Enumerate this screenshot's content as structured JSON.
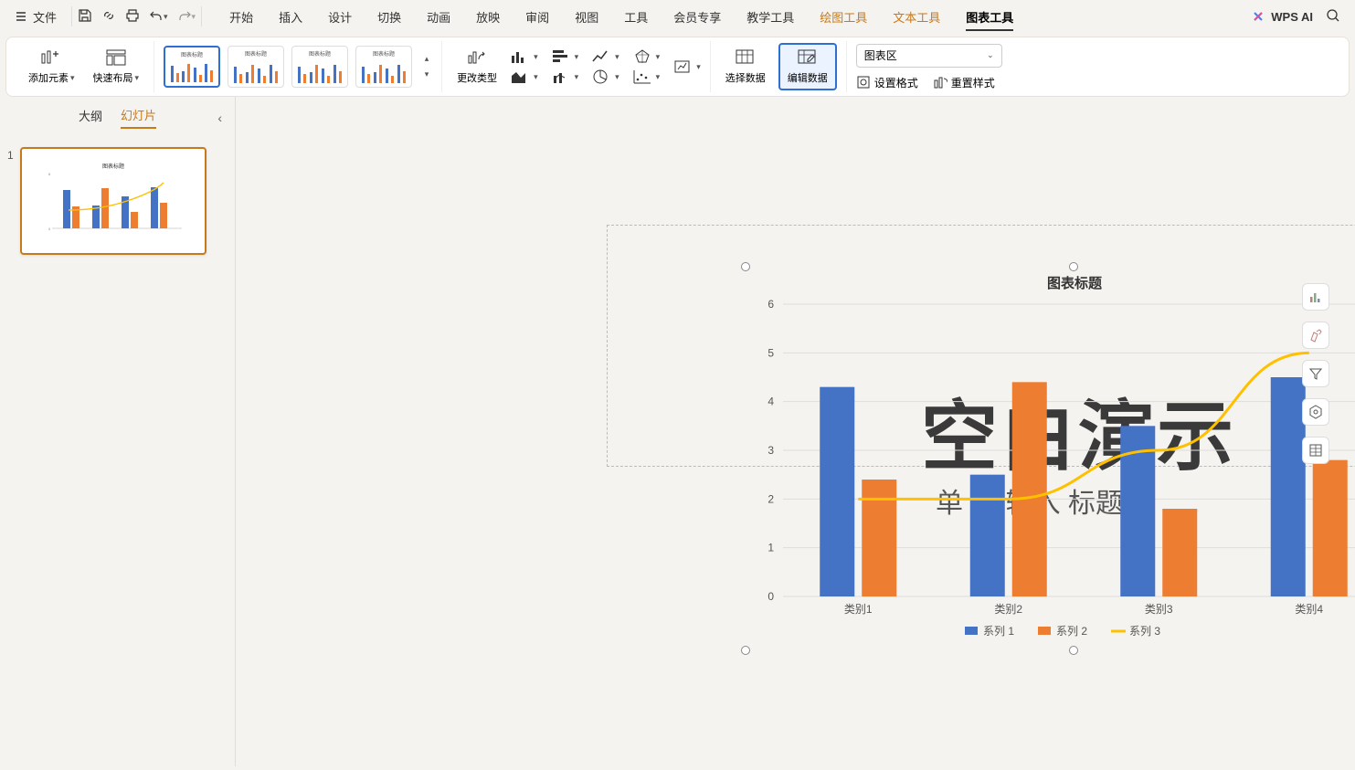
{
  "menu": {
    "file": "文件",
    "tabs": [
      "开始",
      "插入",
      "设计",
      "切换",
      "动画",
      "放映",
      "审阅",
      "视图",
      "工具",
      "会员专享",
      "教学工具"
    ],
    "accent_tabs": [
      "绘图工具",
      "文本工具"
    ],
    "active_tab": "图表工具",
    "wps_ai": "WPS AI"
  },
  "ribbon": {
    "add_element": "添加元素",
    "quick_layout": "快速布局",
    "change_type": "更改类型",
    "select_data": "选择数据",
    "edit_data": "编辑数据",
    "chart_area": "图表区",
    "set_format": "设置格式",
    "reset_style": "重置样式"
  },
  "side": {
    "outline": "大纲",
    "slides": "幻灯片",
    "slide_num": "1"
  },
  "slide": {
    "title_placeholder": "空白演示",
    "subtitle_placeholder": "单    此    输入    标题"
  },
  "right_tools": {
    "t1": "chart-elements",
    "t2": "format-brush",
    "t3": "filter",
    "t4": "settings-hex",
    "t5": "data-table"
  },
  "chart_data": {
    "type": "bar+line",
    "title": "图表标题",
    "categories": [
      "类别1",
      "类别2",
      "类别3",
      "类别4"
    ],
    "series": [
      {
        "name": "系列 1",
        "type": "bar",
        "color": "#4472c4",
        "values": [
          4.3,
          2.5,
          3.5,
          4.5
        ]
      },
      {
        "name": "系列 2",
        "type": "bar",
        "color": "#ed7d31",
        "values": [
          2.4,
          4.4,
          1.8,
          2.8
        ]
      },
      {
        "name": "系列 3",
        "type": "line",
        "color": "#ffc000",
        "values": [
          2.0,
          2.0,
          3.0,
          5.0
        ]
      }
    ],
    "ylim": [
      0,
      6
    ],
    "yticks": [
      0,
      1,
      2,
      3,
      4,
      5,
      6
    ],
    "xlabel": "",
    "ylabel": ""
  }
}
